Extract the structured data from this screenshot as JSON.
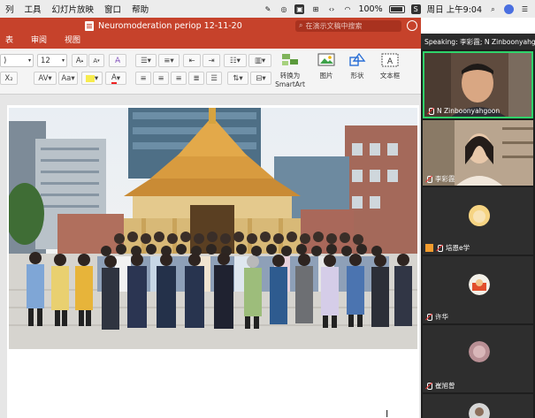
{
  "menubar": {
    "items": [
      "列",
      "工具",
      "幻灯片放映",
      "窗口",
      "帮助"
    ],
    "battery": "100%",
    "clock": "周日 上午9:04"
  },
  "window": {
    "title": "Neuromoderation periop 12-11-20",
    "search_placeholder": "在演示文稿中搜索"
  },
  "ribbon": {
    "tabs": [
      "表",
      "审阅",
      "视图"
    ],
    "font_name": ")",
    "font_size": "12",
    "smartart_label_1": "转换为",
    "smartart_label_2": "SmartArt",
    "picture_label": "图片",
    "shape_label": "形状",
    "textbox_label": "文本框",
    "grow_font": "A",
    "shrink_font": "A",
    "subscript": "X₂",
    "spacing": "AV",
    "case": "Aa",
    "font_color": "A"
  },
  "zoom": {
    "speaking": "Speaking: 李彩霞; N Zinboonyahgoon",
    "participants": [
      {
        "name": "N Zinboonyahgoon",
        "type": "video"
      },
      {
        "name": "李彩霞",
        "type": "video"
      },
      {
        "name": "培恩e学",
        "type": "avatar"
      },
      {
        "name": "许华",
        "type": "avatar"
      },
      {
        "name": "崔旭曾",
        "type": "avatar"
      },
      {
        "name": "",
        "type": "avatar"
      }
    ]
  },
  "colors": {
    "ppt_accent": "#c6422b",
    "zoom_bg": "#1e1e1e",
    "active_speaker": "#2fd36a"
  }
}
